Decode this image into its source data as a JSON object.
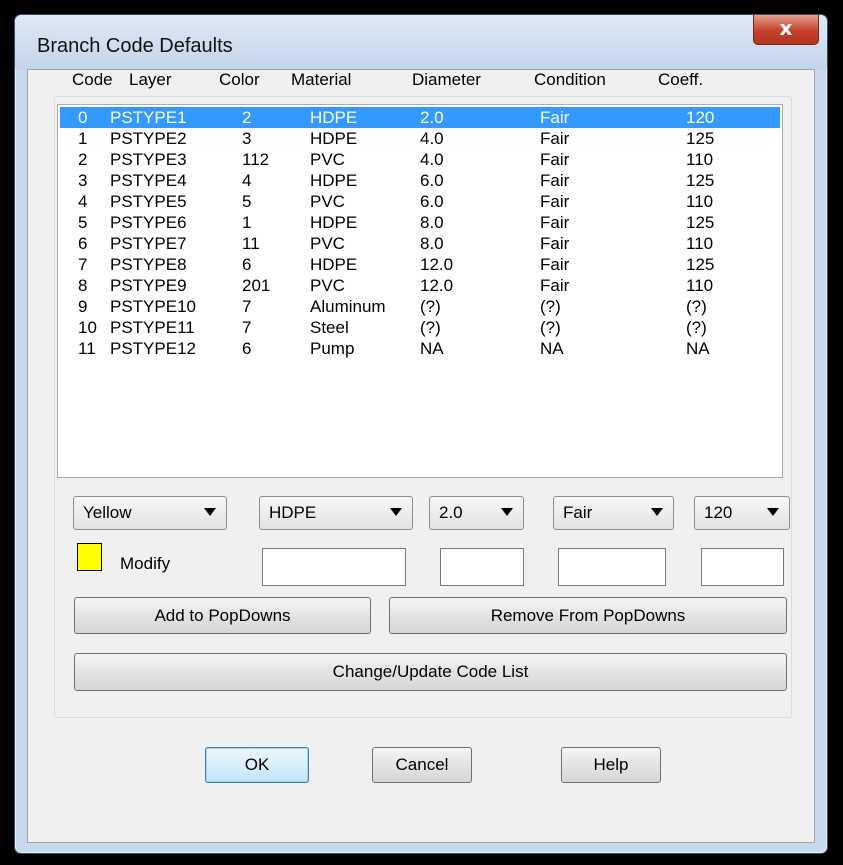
{
  "window": {
    "title": "Branch Code Defaults",
    "close_glyph": "x"
  },
  "columns": [
    "Code",
    "Layer",
    "Color",
    "Material",
    "Diameter",
    "Condition",
    "Coeff."
  ],
  "rows": [
    {
      "code": "0",
      "layer": "PSTYPE1",
      "color": "2",
      "material": "HDPE",
      "diameter": "2.0",
      "condition": "Fair",
      "coeff": "120"
    },
    {
      "code": "1",
      "layer": "PSTYPE2",
      "color": "3",
      "material": "HDPE",
      "diameter": "4.0",
      "condition": "Fair",
      "coeff": "125"
    },
    {
      "code": "2",
      "layer": "PSTYPE3",
      "color": "112",
      "material": "PVC",
      "diameter": "4.0",
      "condition": "Fair",
      "coeff": "110"
    },
    {
      "code": "3",
      "layer": "PSTYPE4",
      "color": "4",
      "material": "HDPE",
      "diameter": "6.0",
      "condition": "Fair",
      "coeff": "125"
    },
    {
      "code": "4",
      "layer": "PSTYPE5",
      "color": "5",
      "material": "PVC",
      "diameter": "6.0",
      "condition": "Fair",
      "coeff": "110"
    },
    {
      "code": "5",
      "layer": "PSTYPE6",
      "color": "1",
      "material": "HDPE",
      "diameter": "8.0",
      "condition": "Fair",
      "coeff": "125"
    },
    {
      "code": "6",
      "layer": "PSTYPE7",
      "color": "11",
      "material": "PVC",
      "diameter": "8.0",
      "condition": "Fair",
      "coeff": "110"
    },
    {
      "code": "7",
      "layer": "PSTYPE8",
      "color": "6",
      "material": "HDPE",
      "diameter": "12.0",
      "condition": "Fair",
      "coeff": "125"
    },
    {
      "code": "8",
      "layer": "PSTYPE9",
      "color": "201",
      "material": "PVC",
      "diameter": "12.0",
      "condition": "Fair",
      "coeff": "110"
    },
    {
      "code": "9",
      "layer": "PSTYPE10",
      "color": "7",
      "material": "Aluminum",
      "diameter": "(?)",
      "condition": "(?)",
      "coeff": "(?)"
    },
    {
      "code": "10",
      "layer": "PSTYPE11",
      "color": "7",
      "material": "Steel",
      "diameter": "(?)",
      "condition": "(?)",
      "coeff": "(?)"
    },
    {
      "code": "11",
      "layer": "PSTYPE12",
      "color": "6",
      "material": "Pump",
      "diameter": "NA",
      "condition": "NA",
      "coeff": "NA"
    }
  ],
  "selected_row_index": 0,
  "dropdowns": {
    "color": "Yellow",
    "material": "HDPE",
    "diameter": "2.0",
    "condition": "Fair",
    "coeff": "120"
  },
  "swatch_color": "#ffff00",
  "modify_label": "Modify",
  "buttons": {
    "add_popdowns": "Add to PopDowns",
    "remove_popdowns": "Remove From PopDowns",
    "change_update": "Change/Update Code List",
    "ok": "OK",
    "cancel": "Cancel",
    "help": "Help"
  }
}
